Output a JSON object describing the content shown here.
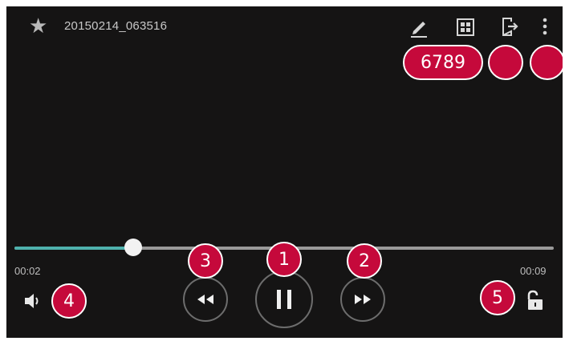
{
  "header": {
    "title": "20150214_063516",
    "icons": [
      "star-icon",
      "edit-icon",
      "gallery-icon",
      "share-icon",
      "more-icon"
    ]
  },
  "callouts": {
    "play_pause": "1",
    "fast_forward": "2",
    "rewind": "3",
    "volume": "4",
    "lock": "5",
    "top_tools": "6789"
  },
  "player": {
    "elapsed": "00:02",
    "duration": "00:09",
    "progress_fraction": 0.22
  },
  "colors": {
    "background": "#151414",
    "accent": "#4fb2ad",
    "callout": "#c5093b"
  }
}
